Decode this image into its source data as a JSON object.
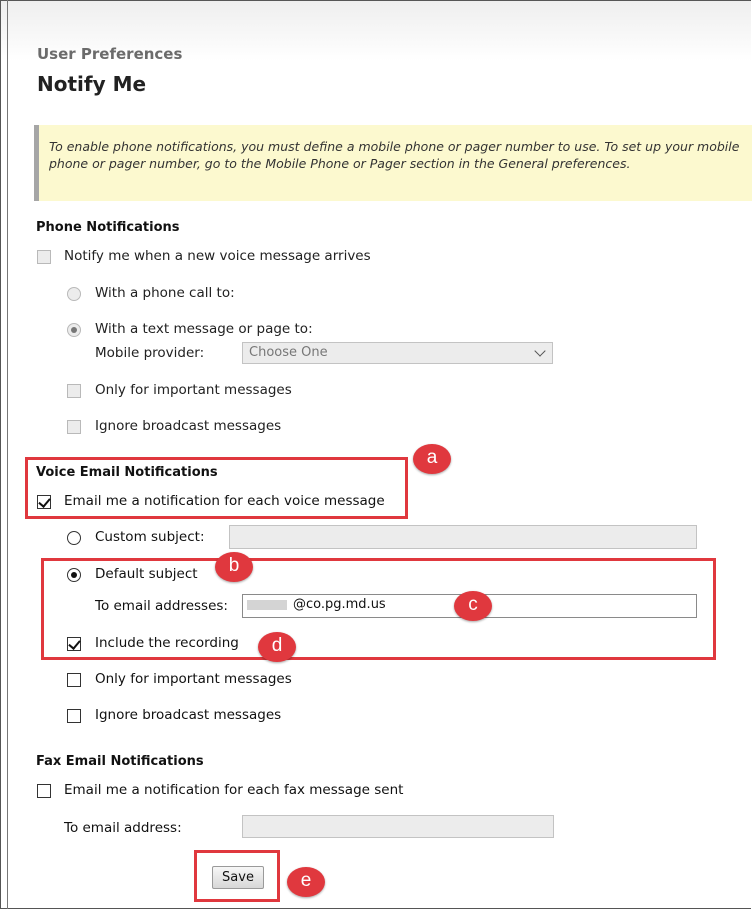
{
  "header": {
    "breadcrumb": "User Preferences",
    "title": "Notify Me"
  },
  "notice": {
    "text": "To enable phone notifications, you must define a mobile phone or pager number to use. To set up your mobile phone or pager number, go to the Mobile Phone or Pager section in the General preferences."
  },
  "phone": {
    "heading": "Phone Notifications",
    "notify_label": "Notify me when a new voice message arrives",
    "notify_checked": false,
    "phone_call_label": "With a phone call to:",
    "text_message_label": "With a text message or page to:",
    "text_message_selected": true,
    "provider_label": "Mobile provider:",
    "provider_value": "Choose One",
    "important_label": "Only for important messages",
    "broadcast_label": "Ignore broadcast messages"
  },
  "voice_email": {
    "heading": "Voice Email Notifications",
    "email_label": "Email me a notification for each voice message",
    "email_checked": true,
    "custom_subject_label": "Custom subject:",
    "custom_subject_value": "",
    "default_subject_label": "Default subject",
    "default_subject_selected": true,
    "to_label": "To email addresses:",
    "to_value": "@co.pg.md.us",
    "include_recording_label": "Include the recording",
    "include_recording_checked": true,
    "important_label": "Only for important messages",
    "broadcast_label": "Ignore broadcast messages"
  },
  "fax_email": {
    "heading": "Fax Email Notifications",
    "email_label": "Email me a notification for each fax message sent",
    "to_label": "To email address:",
    "to_value": ""
  },
  "actions": {
    "save_label": "Save"
  },
  "annotations": {
    "a": "a",
    "b": "b",
    "c": "c",
    "d": "d",
    "e": "e",
    "color": "#e0383e"
  }
}
